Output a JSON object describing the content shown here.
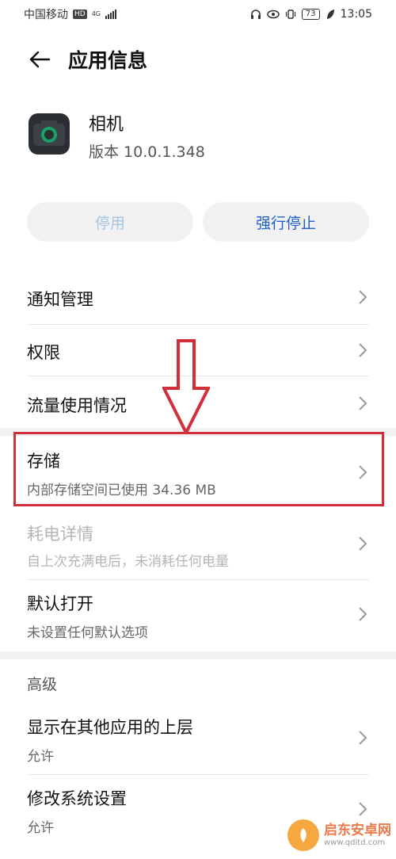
{
  "status_bar": {
    "carrier": "中国移动",
    "hd_badge": "HD",
    "network": "4G",
    "battery": "73",
    "time": "13:05"
  },
  "header": {
    "title": "应用信息"
  },
  "app": {
    "name": "相机",
    "version": "版本 10.0.1.348"
  },
  "buttons": {
    "disable": "停用",
    "force_stop": "强行停止"
  },
  "list": {
    "notifications": "通知管理",
    "permissions": "权限",
    "data_usage": "流量使用情况",
    "storage_title": "存储",
    "storage_sub": "内部存储空间已使用 34.36 MB",
    "battery_title": "耗电详情",
    "battery_sub": "自上次充满电后，未消耗任何电量",
    "default_title": "默认打开",
    "default_sub": "未设置任何默认选项",
    "advanced_label": "高级",
    "overlay_title": "显示在其他应用的上层",
    "overlay_sub": "允许",
    "system_title": "修改系统设置",
    "system_sub": "允许"
  },
  "watermark": {
    "name": "启东安卓网",
    "url": "www.qdltd.com"
  },
  "colors": {
    "accent": "#1f5fcc",
    "disabled_text": "#a7c3e6",
    "highlight": "#d1303a",
    "band": "#f2f2f2"
  }
}
